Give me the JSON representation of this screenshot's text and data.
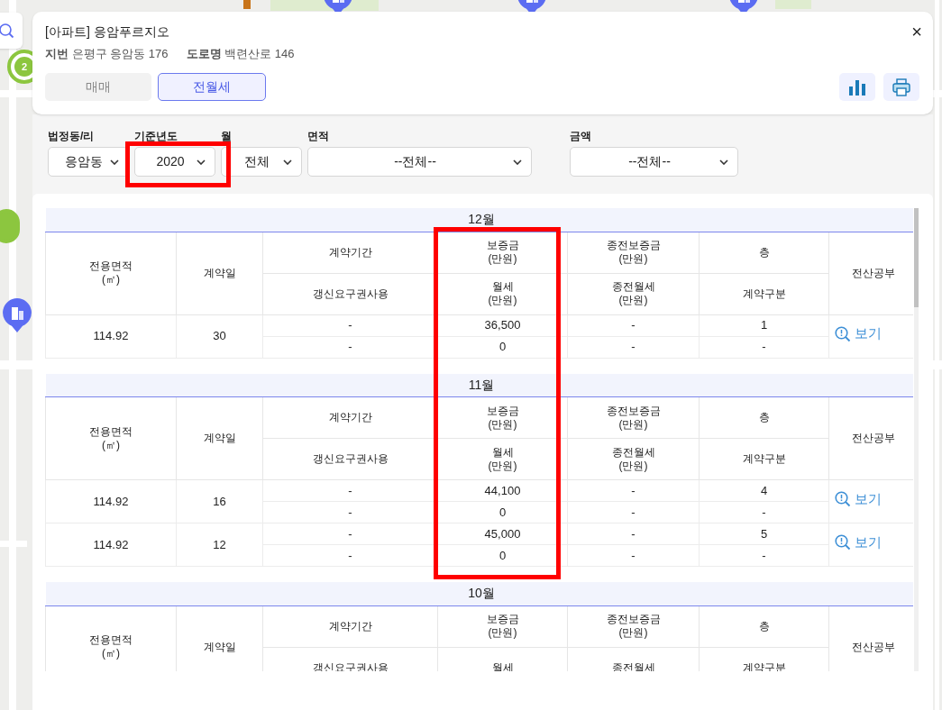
{
  "map": {
    "cluster_count": "2"
  },
  "header": {
    "title": "[아파트] 응암푸르지오",
    "address": [
      {
        "label": "지번",
        "value": "은평구 응암동 176"
      },
      {
        "label": "도로명",
        "value": "백련산로 146"
      }
    ],
    "close": "×"
  },
  "tabs": [
    {
      "label": "매매",
      "selected": false
    },
    {
      "label": "전월세",
      "selected": true
    }
  ],
  "filters": [
    {
      "label": "법정동/리",
      "value": "응암동"
    },
    {
      "label": "기준년도",
      "value": "2020"
    },
    {
      "label": "월",
      "value": "전체"
    },
    {
      "label": "면적",
      "value": "--전체--"
    },
    {
      "label": "금액",
      "value": "--전체--"
    }
  ],
  "months": [
    {
      "title": "12월",
      "headers": {
        "area": "전용면적\n(㎡)",
        "day": "계약일",
        "period": "계약기간",
        "deposit": "보증금\n(만원)",
        "prev_deposit": "종전보증금\n(만원)",
        "floor": "층",
        "registry": "전산공부",
        "renewal": "갱신요구권사용",
        "rent": "월세\n(만원)",
        "prev_rent": "종전월세\n(만원)",
        "contract_type": "계약구분"
      },
      "rows": [
        {
          "area": "114.92",
          "day": "30",
          "period": "-",
          "deposit": "36,500",
          "prev_deposit": "-",
          "floor": "1",
          "renewal": "-",
          "rent": "0",
          "prev_rent": "-",
          "contract_type": "-",
          "link": "보기"
        }
      ]
    },
    {
      "title": "11월",
      "headers": {
        "area": "전용면적\n(㎡)",
        "day": "계약일",
        "period": "계약기간",
        "deposit": "보증금\n(만원)",
        "prev_deposit": "종전보증금\n(만원)",
        "floor": "층",
        "registry": "전산공부",
        "renewal": "갱신요구권사용",
        "rent": "월세\n(만원)",
        "prev_rent": "종전월세\n(만원)",
        "contract_type": "계약구분"
      },
      "rows": [
        {
          "area": "114.92",
          "day": "16",
          "period": "-",
          "deposit": "44,100",
          "prev_deposit": "-",
          "floor": "4",
          "renewal": "-",
          "rent": "0",
          "prev_rent": "-",
          "contract_type": "-",
          "link": "보기"
        },
        {
          "area": "114.92",
          "day": "12",
          "period": "-",
          "deposit": "45,000",
          "prev_deposit": "-",
          "floor": "5",
          "renewal": "-",
          "rent": "0",
          "prev_rent": "-",
          "contract_type": "-",
          "link": "보기"
        }
      ]
    },
    {
      "title": "10월",
      "headers": {
        "area": "전용면적\n(㎡)",
        "day": "계약일",
        "period": "계약기간",
        "deposit": "보증금\n(만원)",
        "prev_deposit": "종전보증금\n(만원)",
        "floor": "층",
        "registry": "전산공부",
        "renewal": "갱신요구권사용",
        "rent": "월세",
        "prev_rent": "종전월세",
        "contract_type": "계약구분"
      }
    }
  ]
}
